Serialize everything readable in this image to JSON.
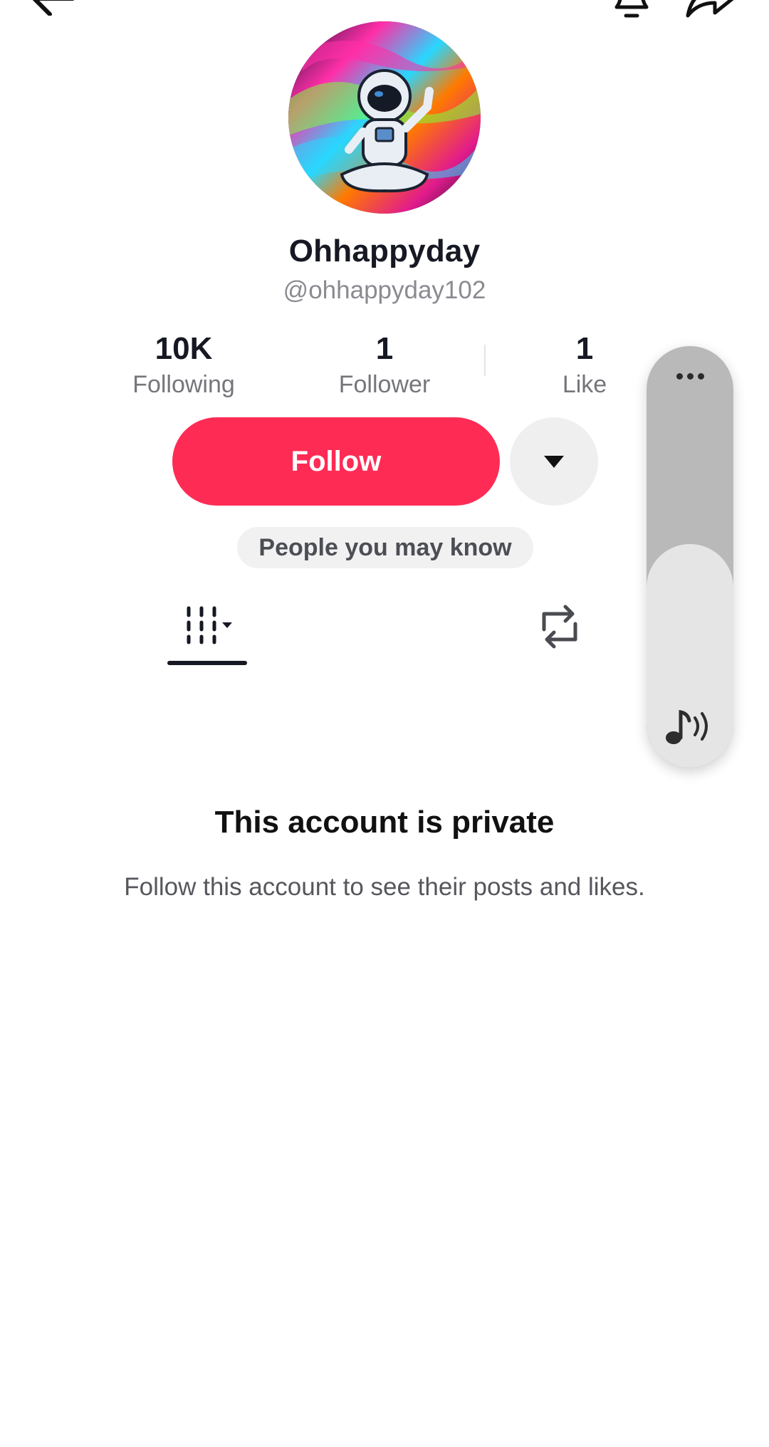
{
  "header": {
    "back_icon": "back-arrow-icon",
    "bell_icon": "bell-icon",
    "share_icon": "share-icon"
  },
  "profile": {
    "display_name": "Ohhappyday",
    "username": "@ohhappyday102",
    "avatar_icon": "astronaut-avatar"
  },
  "stats": [
    {
      "value": "10K",
      "label": "Following"
    },
    {
      "value": "1",
      "label": "Follower"
    },
    {
      "value": "1",
      "label": "Like"
    }
  ],
  "actions": {
    "follow_label": "Follow",
    "more_icon": "caret-down-icon",
    "people_you_may_know": "People you may know"
  },
  "tabs": {
    "videos_icon": "videos-grid-icon",
    "repost_icon": "repost-icon"
  },
  "side_panel": {
    "more_icon": "more-dots-icon",
    "audio_icon": "music-volume-icon"
  },
  "private": {
    "title": "This account is private",
    "subtitle": "Follow this account to see their posts and likes."
  },
  "colors": {
    "follow": "#fe2c55",
    "text": "#161823",
    "muted": "#8a8b91"
  }
}
